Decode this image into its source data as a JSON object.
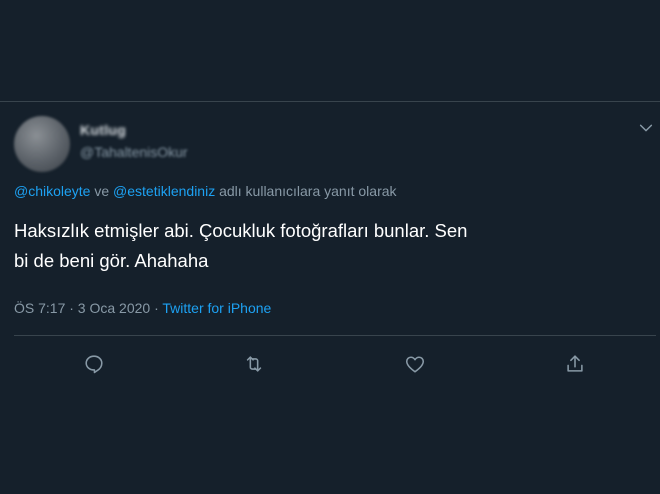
{
  "tweet": {
    "author_name": "Kutlug",
    "author_handle": "@TahaltenisOkur",
    "reply_mention_1": "@chikoleyte",
    "reply_connector": " ve ",
    "reply_mention_2": "@estetiklendiniz",
    "reply_suffix": " adlı kullanıcılara yanıt olarak",
    "text_line_1": "Haksızlık etmişler abi. Çocukluk fotoğrafları bunlar. Sen",
    "text_line_2": "bi de beni gör. Ahahaha",
    "timestamp": "ÖS 7:17 · 3 Oca 2020 · ",
    "source": "Twitter for iPhone"
  },
  "icons": {
    "reply": "reply-icon",
    "retweet": "retweet-icon",
    "like": "like-icon",
    "share": "share-icon",
    "caret": "chevron-down-icon"
  },
  "colors": {
    "background": "#15202b",
    "divider": "#38444d",
    "secondary_text": "#8899a6",
    "accent": "#1da1f2",
    "primary_text": "#ffffff"
  }
}
